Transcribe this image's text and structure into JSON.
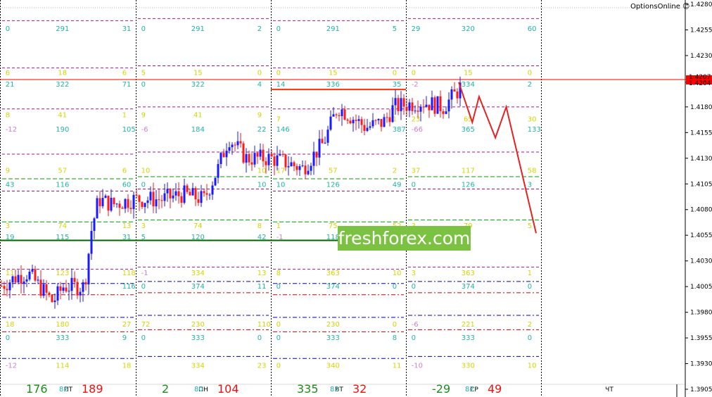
{
  "brand": "OptionsOnline ☺",
  "watermark": "freshforex.com",
  "colors": {
    "bull": "#1a1aff",
    "bear": "#ff1a1a",
    "day_sep": "#000000",
    "resistance": "#ff3300",
    "support": "#006600",
    "forecast": "#e52222",
    "current_price_bg": "#ff0000",
    "cyan": "#20b2aa",
    "yellow": "#d4d400",
    "pink": "#d080d0",
    "count_green": "#1c8c1c",
    "count_red": "#ee1111"
  },
  "chart_data": {
    "type": "candlestick",
    "symbol_price_axis": {
      "min": 1.3905,
      "max": 1.428,
      "ticks": [
        "1.4280",
        "1.4255",
        "1.4230",
        "1.4204",
        "1.4180",
        "1.4155",
        "1.4130",
        "1.4105",
        "1.4080",
        "1.4055",
        "1.4030",
        "1.4005",
        "1.3980",
        "1.3955",
        "1.3930",
        "1.3905"
      ]
    },
    "current_price": "1.4204",
    "current_price_overlap": "1.4207",
    "days": [
      {
        "label": "ПТ",
        "count_up": "176",
        "count_down": "189",
        "bottom_small": "82"
      },
      {
        "label": "ПН",
        "count_up": "2",
        "count_down": "104",
        "bottom_small": "80"
      },
      {
        "label": "ВТ",
        "count_up": "335",
        "count_down": "32",
        "bottom_small": "82"
      },
      {
        "label": "СР",
        "count_up": "-29",
        "count_down": "49",
        "bottom_small": "82"
      },
      {
        "label": "ЧТ",
        "count_up": "",
        "count_down": "",
        "bottom_small": ""
      }
    ],
    "level_labels": [
      [
        {
          "p": 1.4256,
          "t": [
            "0",
            "291",
            "31"
          ],
          "c": "cyan"
        },
        {
          "p": 1.4213,
          "t": [
            "6",
            "18",
            "6"
          ],
          "c": "yellow"
        },
        {
          "p": 1.4202,
          "t": [
            "21",
            "322",
            "71"
          ],
          "c": "cyan"
        },
        {
          "p": 1.4172,
          "t": [
            "8",
            "41",
            "1"
          ],
          "c": "yellow"
        },
        {
          "p": 1.4158,
          "t": [
            "-12",
            "190",
            "105"
          ],
          "c": "pinkcyan"
        },
        {
          "p": 1.4118,
          "t": [
            "9",
            "57",
            "6"
          ],
          "c": "yellow"
        },
        {
          "p": 1.4104,
          "t": [
            "43",
            "116",
            "60"
          ],
          "c": "cyan"
        },
        {
          "p": 1.4064,
          "t": [
            "3",
            "74",
            "13"
          ],
          "c": "yellow"
        },
        {
          "p": 1.4053,
          "t": [
            "19",
            "115",
            "31"
          ],
          "c": "cyan"
        },
        {
          "p": 1.4018,
          "t": [
            "11",
            "123",
            "118"
          ],
          "c": "yellow"
        },
        {
          "p": 1.4005,
          "t": [
            "",
            "",
            "116"
          ],
          "c": "cyan"
        },
        {
          "p": 1.3968,
          "t": [
            "18",
            "180",
            "27"
          ],
          "c": "yellow"
        },
        {
          "p": 1.3955,
          "t": [
            "0",
            "333",
            "9"
          ],
          "c": "cyan"
        },
        {
          "p": 1.3928,
          "t": [
            "-12",
            "114",
            "18"
          ],
          "c": "pinkyellow"
        }
      ],
      [
        {
          "p": 1.4256,
          "t": [
            "0",
            "291",
            "2"
          ],
          "c": "cyan"
        },
        {
          "p": 1.4213,
          "t": [
            "5",
            "15",
            "0"
          ],
          "c": "yellow"
        },
        {
          "p": 1.4202,
          "t": [
            "0",
            "322",
            "4"
          ],
          "c": "cyan"
        },
        {
          "p": 1.4172,
          "t": [
            "9",
            "41",
            "9"
          ],
          "c": "yellow"
        },
        {
          "p": 1.4158,
          "t": [
            "-6",
            "184",
            "22"
          ],
          "c": "pinkcyan"
        },
        {
          "p": 1.4118,
          "t": [
            "10",
            "",
            "10"
          ],
          "c": "yellow"
        },
        {
          "p": 1.4104,
          "t": [
            "0",
            "",
            "10"
          ],
          "c": "cyan"
        },
        {
          "p": 1.4064,
          "t": [
            "3",
            "74",
            "8"
          ],
          "c": "yellow"
        },
        {
          "p": 1.4053,
          "t": [
            "5",
            "120",
            "42"
          ],
          "c": "cyan"
        },
        {
          "p": 1.4018,
          "t": [
            "-1",
            "334",
            "13"
          ],
          "c": "pinkyellow"
        },
        {
          "p": 1.4005,
          "t": [
            "0",
            "374",
            "11"
          ],
          "c": "cyan"
        },
        {
          "p": 1.3968,
          "t": [
            "72",
            "230",
            "110"
          ],
          "c": "yellow"
        },
        {
          "p": 1.3955,
          "t": [
            "0",
            "333",
            "0"
          ],
          "c": "cyan"
        },
        {
          "p": 1.3928,
          "t": [
            "",
            "334",
            "23"
          ],
          "c": "yellow"
        }
      ],
      [
        {
          "p": 1.4256,
          "t": [
            "0",
            "291",
            "5"
          ],
          "c": "cyan"
        },
        {
          "p": 1.4213,
          "t": [
            "0",
            "15",
            "0"
          ],
          "c": "yellow"
        },
        {
          "p": 1.4202,
          "t": [
            "14",
            "336",
            "35"
          ],
          "c": "cyan"
        },
        {
          "p": 1.4168,
          "t": [
            "7",
            "",
            "1"
          ],
          "c": "yellow"
        },
        {
          "p": 1.4158,
          "t": [
            "146",
            "",
            "387"
          ],
          "c": "cyan"
        },
        {
          "p": 1.4118,
          "t": [
            "17",
            "57",
            "2"
          ],
          "c": "yellow"
        },
        {
          "p": 1.4104,
          "t": [
            "10",
            "126",
            "49"
          ],
          "c": "cyan"
        },
        {
          "p": 1.4064,
          "t": [
            "1",
            "75",
            "52"
          ],
          "c": "yellow"
        },
        {
          "p": 1.4053,
          "t": [
            "-1",
            "118",
            ""
          ],
          "c": "pinkcyan"
        },
        {
          "p": 1.4018,
          "t": [
            "8",
            "363",
            "10"
          ],
          "c": "yellow"
        },
        {
          "p": 1.4005,
          "t": [
            "0",
            "374",
            "0"
          ],
          "c": "cyan"
        },
        {
          "p": 1.3968,
          "t": [
            "0",
            "230",
            "0"
          ],
          "c": "yellow"
        },
        {
          "p": 1.3955,
          "t": [
            "0",
            "333",
            "8"
          ],
          "c": "cyan"
        },
        {
          "p": 1.3928,
          "t": [
            "0",
            "340",
            "11"
          ],
          "c": "yellow"
        }
      ],
      [
        {
          "p": 1.4256,
          "t": [
            "29",
            "320",
            "60"
          ],
          "c": "cyan"
        },
        {
          "p": 1.4213,
          "t": [
            "0",
            "15",
            "0"
          ],
          "c": "yellow"
        },
        {
          "p": 1.4202,
          "t": [
            "-2",
            "334",
            "2"
          ],
          "c": "pinkcyan"
        },
        {
          "p": 1.4168,
          "t": [
            "23",
            "65",
            "30"
          ],
          "c": "yellow"
        },
        {
          "p": 1.4158,
          "t": [
            "-66",
            "365",
            "133"
          ],
          "c": "pinkcyan"
        },
        {
          "p": 1.4118,
          "t": [
            "37",
            "117",
            "58"
          ],
          "c": "yellow"
        },
        {
          "p": 1.4104,
          "t": [
            "0",
            "126",
            "3"
          ],
          "c": "cyan"
        },
        {
          "p": 1.4064,
          "t": [
            "3",
            "79",
            "5"
          ],
          "c": "yellow"
        },
        {
          "p": 1.4018,
          "t": [
            "3",
            "363",
            "1"
          ],
          "c": "yellow"
        },
        {
          "p": 1.4005,
          "t": [
            "0",
            "374",
            "0"
          ],
          "c": "cyan"
        },
        {
          "p": 1.3968,
          "t": [
            "-6",
            "221",
            "2"
          ],
          "c": "pinkyellow"
        },
        {
          "p": 1.3955,
          "t": [
            "0",
            "333",
            "0"
          ],
          "c": "cyan"
        },
        {
          "p": 1.3928,
          "t": [
            "-10",
            "330",
            "10"
          ],
          "c": "pinkyellow"
        }
      ]
    ],
    "forecast_path": [
      [
        1.4204,
        0
      ],
      [
        1.4165,
        0.1
      ],
      [
        1.419,
        0.15
      ],
      [
        1.415,
        0.27
      ],
      [
        1.418,
        0.35
      ],
      [
        1.4057,
        0.57
      ]
    ]
  }
}
